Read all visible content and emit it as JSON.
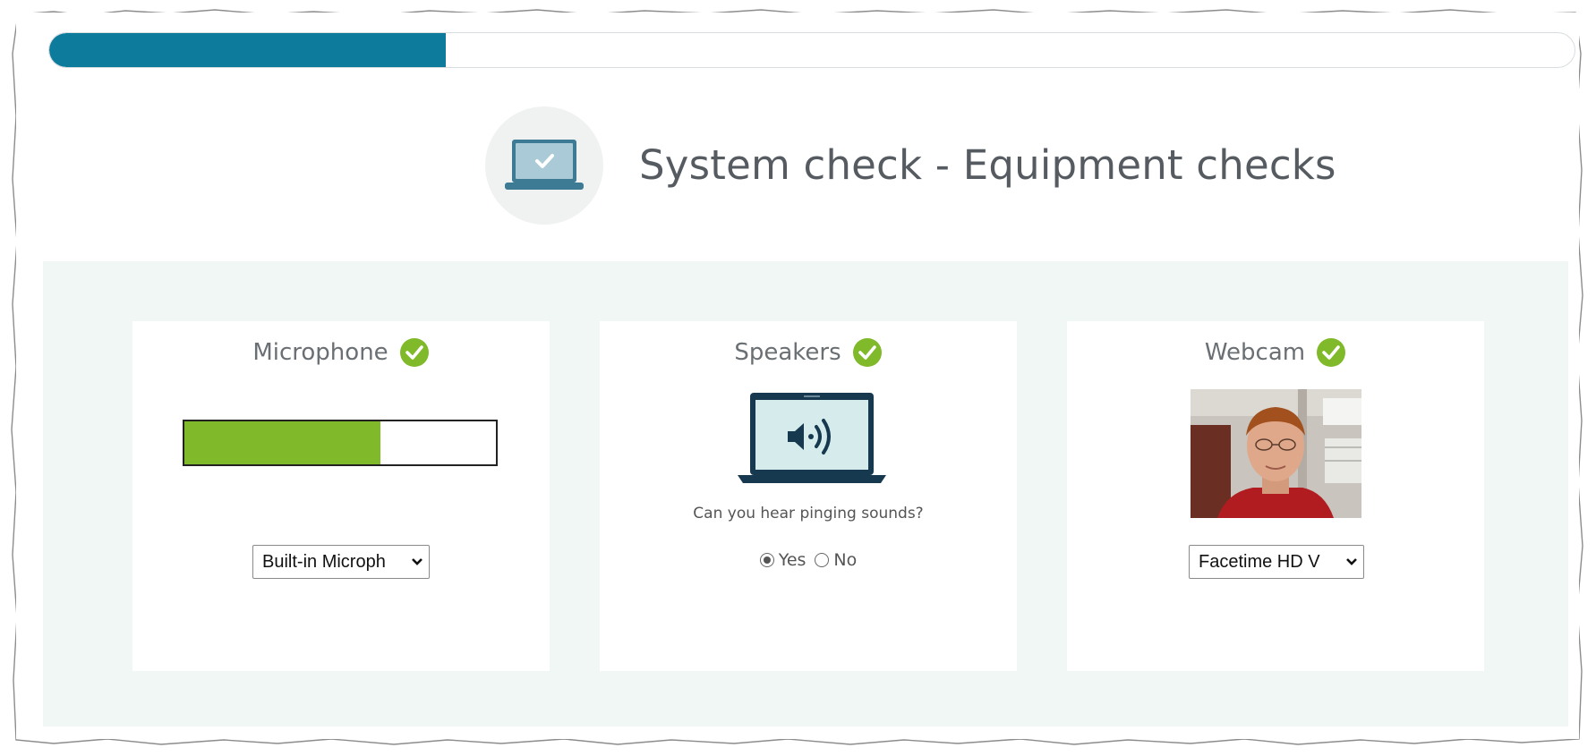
{
  "progress": {
    "fraction": 0.26
  },
  "header": {
    "title": "System check - Equipment checks",
    "icon": "laptop-check-icon"
  },
  "cards": {
    "microphone": {
      "title": "Microphone",
      "status_icon": "check-circle-icon",
      "level_fraction": 0.63,
      "device": "Built-in Microph"
    },
    "speakers": {
      "title": "Speakers",
      "status_icon": "check-circle-icon",
      "question": "Can you hear pinging sounds?",
      "options": [
        "Yes",
        "No"
      ],
      "selected": "Yes"
    },
    "webcam": {
      "title": "Webcam",
      "status_icon": "check-circle-icon",
      "device": "Facetime HD V"
    }
  },
  "colors": {
    "accent": "#0d7b9b",
    "success": "#80b92a",
    "panel_bg": "#f0f7f5",
    "title_text": "#555b60"
  }
}
